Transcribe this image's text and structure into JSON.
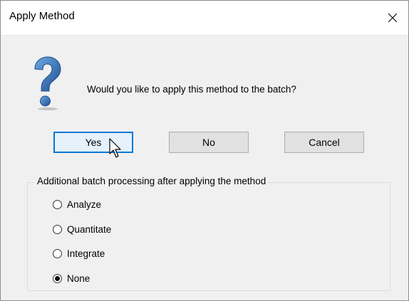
{
  "window": {
    "title": "Apply Method",
    "close_glyph": "✕"
  },
  "message": "Would you like to apply this method to the batch?",
  "icon": "question-icon",
  "buttons": {
    "yes": "Yes",
    "no": "No",
    "cancel": "Cancel"
  },
  "group": {
    "label": "Additional batch processing after applying the method",
    "options": [
      {
        "label": "Analyze",
        "checked": false
      },
      {
        "label": "Quantitate",
        "checked": false
      },
      {
        "label": "Integrate",
        "checked": false
      },
      {
        "label": "None",
        "checked": true
      }
    ]
  },
  "colors": {
    "accent": "#0078d7",
    "icon_blue": "#3f7fc3",
    "icon_dark": "#1f4f8f"
  }
}
